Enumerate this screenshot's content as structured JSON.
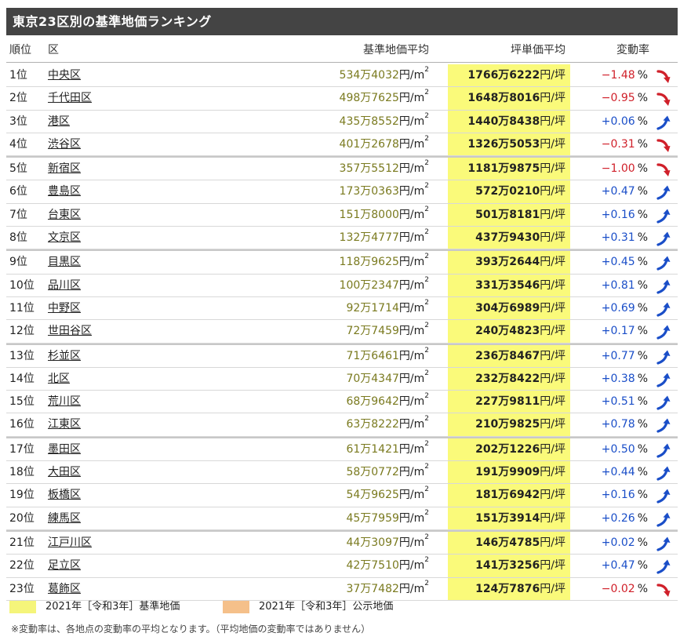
{
  "title": "東京23区別の基準地価ランキング",
  "headers": {
    "rank": "順位",
    "ward": "区",
    "std": "基準地価平均",
    "tsubo": "坪単価平均",
    "chg": "変動率"
  },
  "units": {
    "m2_prefix": "円/m",
    "m2_sup": "2",
    "tsubo": "円/坪",
    "pct": "%"
  },
  "colors": {
    "title_bg": "#444444",
    "highlight": "#fafa7a",
    "legend_std": "#f5f57a",
    "legend_koji": "#f5c08a",
    "up": "#1a4ec8",
    "down": "#d0202a"
  },
  "rows": [
    {
      "rank": "1位",
      "ward": "中央区",
      "std": "534万4032",
      "tsubo": "1766万6222",
      "chg": "−1.48",
      "dir": "down"
    },
    {
      "rank": "2位",
      "ward": "千代田区",
      "std": "498万7625",
      "tsubo": "1648万8016",
      "chg": "−0.95",
      "dir": "down"
    },
    {
      "rank": "3位",
      "ward": "港区",
      "std": "435万8552",
      "tsubo": "1440万8438",
      "chg": "+0.06",
      "dir": "up"
    },
    {
      "rank": "4位",
      "ward": "渋谷区",
      "std": "401万2678",
      "tsubo": "1326万5053",
      "chg": "−0.31",
      "dir": "down"
    },
    {
      "rank": "5位",
      "ward": "新宿区",
      "std": "357万5512",
      "tsubo": "1181万9875",
      "chg": "−1.00",
      "dir": "down"
    },
    {
      "rank": "6位",
      "ward": "豊島区",
      "std": "173万0363",
      "tsubo": "572万0210",
      "chg": "+0.47",
      "dir": "up"
    },
    {
      "rank": "7位",
      "ward": "台東区",
      "std": "151万8000",
      "tsubo": "501万8181",
      "chg": "+0.16",
      "dir": "up"
    },
    {
      "rank": "8位",
      "ward": "文京区",
      "std": "132万4777",
      "tsubo": "437万9430",
      "chg": "+0.31",
      "dir": "up"
    },
    {
      "rank": "9位",
      "ward": "目黒区",
      "std": "118万9625",
      "tsubo": "393万2644",
      "chg": "+0.45",
      "dir": "up"
    },
    {
      "rank": "10位",
      "ward": "品川区",
      "std": "100万2347",
      "tsubo": "331万3546",
      "chg": "+0.81",
      "dir": "up"
    },
    {
      "rank": "11位",
      "ward": "中野区",
      "std": "92万1714",
      "tsubo": "304万6989",
      "chg": "+0.69",
      "dir": "up"
    },
    {
      "rank": "12位",
      "ward": "世田谷区",
      "std": "72万7459",
      "tsubo": "240万4823",
      "chg": "+0.17",
      "dir": "up"
    },
    {
      "rank": "13位",
      "ward": "杉並区",
      "std": "71万6461",
      "tsubo": "236万8467",
      "chg": "+0.77",
      "dir": "up"
    },
    {
      "rank": "14位",
      "ward": "北区",
      "std": "70万4347",
      "tsubo": "232万8422",
      "chg": "+0.38",
      "dir": "up"
    },
    {
      "rank": "15位",
      "ward": "荒川区",
      "std": "68万9642",
      "tsubo": "227万9811",
      "chg": "+0.51",
      "dir": "up"
    },
    {
      "rank": "16位",
      "ward": "江東区",
      "std": "63万8222",
      "tsubo": "210万9825",
      "chg": "+0.78",
      "dir": "up"
    },
    {
      "rank": "17位",
      "ward": "墨田区",
      "std": "61万1421",
      "tsubo": "202万1226",
      "chg": "+0.50",
      "dir": "up"
    },
    {
      "rank": "18位",
      "ward": "大田区",
      "std": "58万0772",
      "tsubo": "191万9909",
      "chg": "+0.44",
      "dir": "up"
    },
    {
      "rank": "19位",
      "ward": "板橋区",
      "std": "54万9625",
      "tsubo": "181万6942",
      "chg": "+0.16",
      "dir": "up"
    },
    {
      "rank": "20位",
      "ward": "練馬区",
      "std": "45万7959",
      "tsubo": "151万3914",
      "chg": "+0.26",
      "dir": "up"
    },
    {
      "rank": "21位",
      "ward": "江戸川区",
      "std": "44万3097",
      "tsubo": "146万4785",
      "chg": "+0.02",
      "dir": "up"
    },
    {
      "rank": "22位",
      "ward": "足立区",
      "std": "42万7510",
      "tsubo": "141万3256",
      "chg": "+0.47",
      "dir": "up"
    },
    {
      "rank": "23位",
      "ward": "葛飾区",
      "std": "37万7482",
      "tsubo": "124万7876",
      "chg": "−0.02",
      "dir": "down"
    }
  ],
  "legend": {
    "std_label": "2021年［令和3年］基準地価",
    "koji_label": "2021年［令和3年］公示地価"
  },
  "note": "※変動率は、各地点の変動率の平均となります。（平均地価の変動率ではありません）"
}
